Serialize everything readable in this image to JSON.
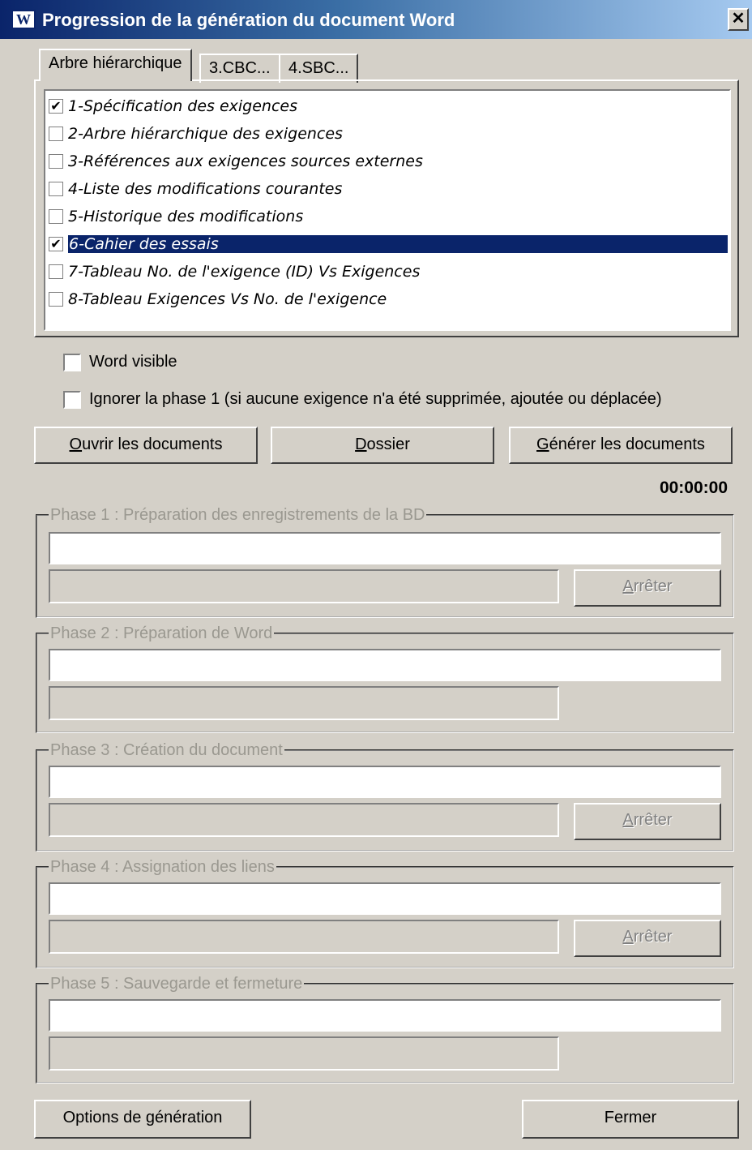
{
  "window": {
    "icon_letter": "W",
    "title": "Progression de la génération du document Word",
    "close_glyph": "✕"
  },
  "tabs": [
    {
      "label": "Arbre hiérarchique",
      "active": true
    },
    {
      "label": "3.CBC...",
      "active": false
    },
    {
      "label": "4.SBC...",
      "active": false
    }
  ],
  "documents": [
    {
      "label": "1-Spécification des exigences",
      "checked": true,
      "check": "✔"
    },
    {
      "label": "2-Arbre hiérarchique des exigences",
      "checked": false,
      "check": ""
    },
    {
      "label": "3-Références aux exigences sources externes",
      "checked": false,
      "check": ""
    },
    {
      "label": "4-Liste des modifications courantes",
      "checked": false,
      "check": ""
    },
    {
      "label": "5-Historique des modifications",
      "checked": false,
      "check": ""
    },
    {
      "label": "6-Cahier des essais",
      "checked": true,
      "check": "✔",
      "selected": true
    },
    {
      "label": "7-Tableau No. de l'exigence (ID) Vs Exigences",
      "checked": false,
      "check": ""
    },
    {
      "label": "8-Tableau Exigences Vs No. de l'exigence",
      "checked": false,
      "check": ""
    }
  ],
  "options": {
    "word_visible": {
      "label": "Word visible",
      "checked": false
    },
    "skip_phase1": {
      "label": "Ignorer la phase 1 (si aucune exigence n'a été supprimée, ajoutée ou déplacée)",
      "checked": false
    }
  },
  "actions": {
    "open_u": "O",
    "open_rest": "uvrir les documents",
    "folder_u": "D",
    "folder_rest": "ossier",
    "generate_u": "G",
    "generate_rest": "énérer les documents"
  },
  "timer": "00:00:00",
  "phases": [
    {
      "title": "Phase 1 : Préparation des enregistrements de la BD",
      "has_stop": true
    },
    {
      "title": "Phase 2 : Préparation de Word",
      "has_stop": false
    },
    {
      "title": "Phase 3 : Création du document",
      "has_stop": true
    },
    {
      "title": "Phase 4 : Assignation des liens",
      "has_stop": true
    },
    {
      "title": "Phase 5 : Sauvegarde et fermeture",
      "has_stop": false
    }
  ],
  "stop": {
    "u": "A",
    "rest": "rrêter"
  },
  "footer": {
    "options_label": "Options de génération",
    "close_label": "Fermer"
  }
}
